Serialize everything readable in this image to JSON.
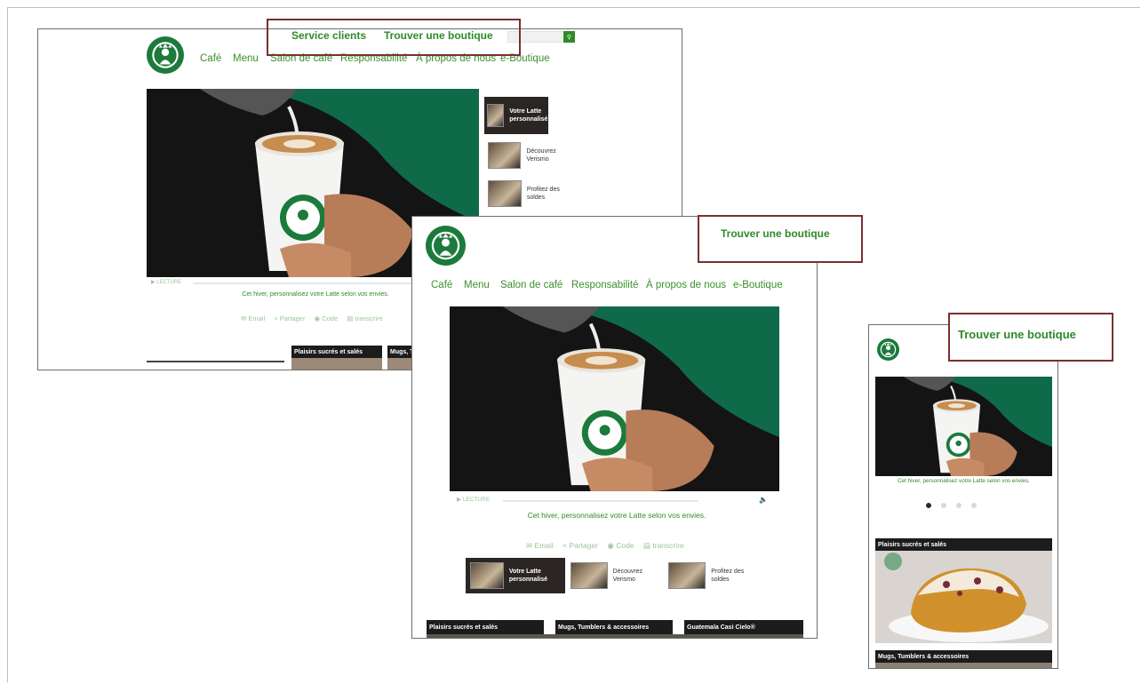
{
  "desktop": {
    "header": {
      "service_label": "Service clients",
      "store_label": "Trouver une boutique"
    },
    "nav": [
      "Café",
      "Menu",
      "Salon de café",
      "Responsabilité",
      "À propos de nous",
      "e-Boutique"
    ],
    "thumbs": [
      {
        "title": "Votre Latte personnalisé",
        "active": true
      },
      {
        "title": "Découvrez Verismo",
        "active": false
      },
      {
        "title": "Profitez des soldes",
        "active": false
      }
    ],
    "player_label": "LECTURE",
    "caption": "Cet hiver, personnalisez votre Latte selon vos envies.",
    "share": [
      "Email",
      "Partager",
      "Code",
      "transcrire"
    ],
    "categories": [
      "Plaisirs sucrés et salés",
      "Mugs, T"
    ]
  },
  "tablet": {
    "header": {
      "store_label": "Trouver une boutique"
    },
    "nav": [
      "Café",
      "Menu",
      "Salon de café",
      "Responsabilité",
      "À propos de nous",
      "e-Boutique"
    ],
    "player_label": "LECTURE",
    "caption": "Cet hiver, personnalisez votre Latte selon vos envies.",
    "share": [
      "Email",
      "Partager",
      "Code",
      "transcrire"
    ],
    "thumbs": [
      {
        "title": "Votre Latte personnalisé",
        "active": true
      },
      {
        "title": "Découvrez Verismo",
        "active": false
      },
      {
        "title": "Profitez des soldes",
        "active": false
      }
    ],
    "categories": [
      "Plaisirs sucrés et salés",
      "Mugs, Tumblers & accessoires",
      "Guatemala Casi Cielo®"
    ]
  },
  "mobile": {
    "header": {
      "store_label": "Trouver une boutique"
    },
    "caption": "Cet hiver, personnalisez votre Latte selon vos envies.",
    "carousel_active": 1,
    "carousel_count": 4,
    "categories": [
      "Plaisirs sucrés et salés",
      "Mugs, Tumblers & accessoires"
    ]
  },
  "colors": {
    "brand_green": "#2f8a2a",
    "highlight_border": "#7a2f2f",
    "category_bar": "#1c1c1c"
  }
}
